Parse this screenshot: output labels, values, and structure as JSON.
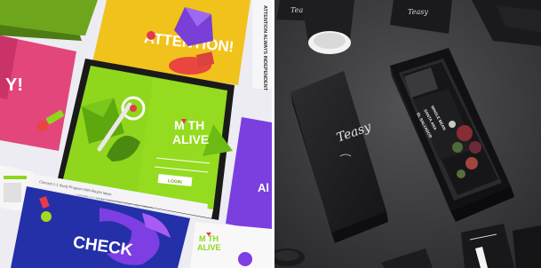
{
  "left_image": {
    "cards": {
      "attention_text": "ATTENTION!",
      "left_partial_text": "Y!",
      "right_partial_text": "Al",
      "check_text": "CHECK",
      "small_card_line_1": "M TH",
      "small_card_line_2": "ALIVE"
    },
    "tablet": {
      "logo_line_1": "M TH",
      "logo_line_2": "ALIVE",
      "button_label": "LOGIN",
      "footer_text": "Concept 1.1 / Design Mathematics Board Topic Platform",
      "dashboard_caption": "Concept 1.1 Study Program With Playful Ideas"
    },
    "vertical_caption": "ATTENTION ALWAYS INDEPENDENT",
    "colors": {
      "yellow": "#f2c21c",
      "pink": "#e2467b",
      "lime": "#8fd61d",
      "purple": "#7b3fe0",
      "blue": "#2430a8",
      "tablet_frame": "#1a1a1a"
    }
  },
  "right_image": {
    "script_logo": "Teasy",
    "jar_label_lines": [
      "EL SALVADOR",
      "SANTA ANA",
      "WHOLE BEAN"
    ],
    "colors": {
      "background": "#3a3a3c",
      "box": "#1c1c1e",
      "paper": "#f4f4f4"
    }
  }
}
